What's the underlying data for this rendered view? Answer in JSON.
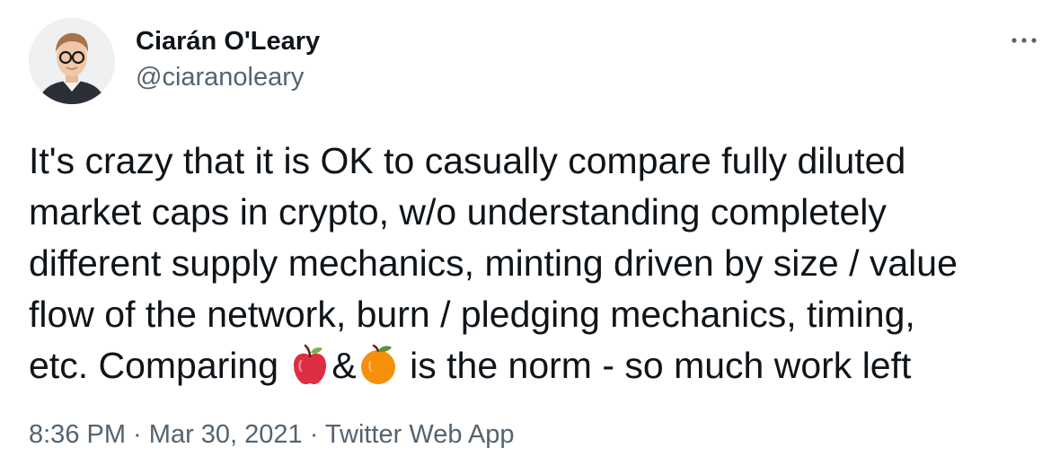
{
  "author": {
    "display_name": "Ciarán O'Leary",
    "handle": "@ciaranoleary",
    "avatar_icon": "profile-photo"
  },
  "more_icon": "more-horizontal-icon",
  "tweet": {
    "lines": [
      "It's crazy that it is OK to casually compare fully diluted",
      "market caps in crypto, w/o understanding completely",
      "different supply mechanics, minting driven by size / value",
      "flow of the network, burn / pledging mechanics, timing,"
    ],
    "last_line_start": "etc. Comparing ",
    "emoji_1": "red-apple-emoji",
    "ampersand": "&",
    "emoji_2": "tangerine-emoji",
    "last_line_end": " is the norm - so much work left"
  },
  "meta": {
    "time": "8:36 PM",
    "separator_1": " · ",
    "date": "Mar 30, 2021",
    "separator_2": " · ",
    "source": "Twitter Web App"
  },
  "colors": {
    "text": "#0f1419",
    "secondary": "#536471",
    "apple": "#dd2e44",
    "orange": "#f4900c"
  }
}
